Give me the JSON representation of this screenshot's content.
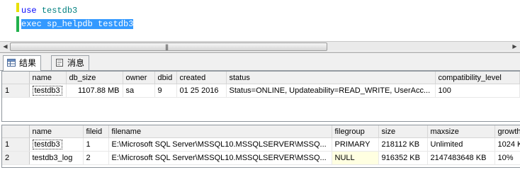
{
  "editor": {
    "line1": {
      "keyword": "use",
      "ident": "testdb3"
    },
    "line2": {
      "selected_text": "exec sp_helpdb testdb3"
    }
  },
  "scrollbar": {
    "grip": "|||"
  },
  "tabs": [
    {
      "label": "结果",
      "icon": "grid-icon",
      "active": true
    },
    {
      "label": "消息",
      "icon": "message-icon",
      "active": false
    }
  ],
  "result1": {
    "columns": [
      "name",
      "db_size",
      "owner",
      "dbid",
      "created",
      "status",
      "compatibility_level"
    ],
    "rows": [
      {
        "n": "1",
        "name": "testdb3",
        "db_size": "1107.88 MB",
        "owner": "sa",
        "dbid": "9",
        "created": "01 25 2016",
        "status": "Status=ONLINE, Updateability=READ_WRITE, UserAcc...",
        "compatibility_level": "100"
      }
    ]
  },
  "result2": {
    "columns": [
      "name",
      "fileid",
      "filename",
      "filegroup",
      "size",
      "maxsize",
      "growth"
    ],
    "rows": [
      {
        "n": "1",
        "name": "testdb3",
        "fileid": "1",
        "filename": "E:\\Microsoft SQL Server\\MSSQL10.MSSQLSERVER\\MSSQ...",
        "filegroup": "PRIMARY",
        "size": "218112 KB",
        "maxsize": "Unlimited",
        "growth": "1024 K"
      },
      {
        "n": "2",
        "name": "testdb3_log",
        "fileid": "2",
        "filename": "E:\\Microsoft SQL Server\\MSSQL10.MSSQLSERVER\\MSSQ...",
        "filegroup": "NULL",
        "size": "916352 KB",
        "maxsize": "2147483648 KB",
        "growth": "10%"
      }
    ]
  }
}
